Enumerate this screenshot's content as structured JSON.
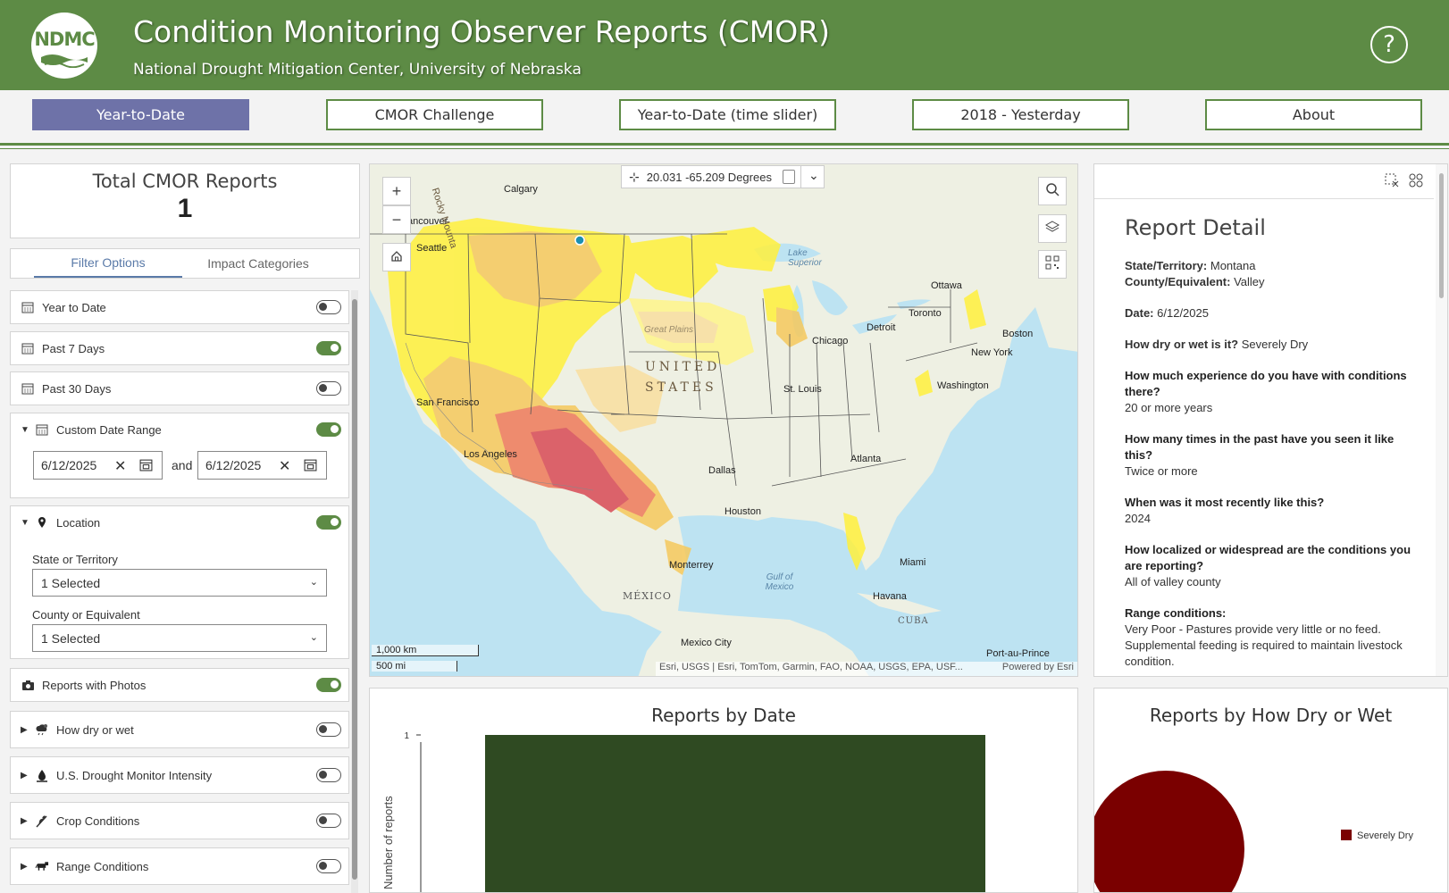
{
  "header": {
    "logo_text": "NDMC",
    "title": "Condition Monitoring Observer Reports (CMOR)",
    "subtitle": "National Drought Mitigation Center, University of Nebraska",
    "help_glyph": "?"
  },
  "nav": {
    "tabs": [
      {
        "label": "Year-to-Date",
        "active": true
      },
      {
        "label": "CMOR Challenge",
        "active": false
      },
      {
        "label": "Year-to-Date (time slider)",
        "active": false
      },
      {
        "label": "2018 - Yesterday",
        "active": false
      },
      {
        "label": "About",
        "active": false
      }
    ]
  },
  "total": {
    "title": "Total CMOR Reports",
    "count": "1"
  },
  "filter_tabs": {
    "filter_options": "Filter Options",
    "impact_categories": "Impact Categories"
  },
  "filters": {
    "year_to_date": {
      "label": "Year to Date",
      "on": false
    },
    "past_7_days": {
      "label": "Past 7 Days",
      "on": true
    },
    "past_30_days": {
      "label": "Past 30 Days",
      "on": false
    },
    "custom_range": {
      "label": "Custom Date Range",
      "on": true,
      "from": "6/12/2025",
      "and_label": "and",
      "to": "6/12/2025"
    },
    "location": {
      "label": "Location",
      "on": true,
      "state_label": "State or Territory",
      "state_value": "1 Selected",
      "county_label": "County or Equivalent",
      "county_value": "1 Selected"
    },
    "photos": {
      "label": "Reports with Photos",
      "on": true
    },
    "how_dry": {
      "label": "How dry or wet",
      "on": false
    },
    "usdm": {
      "label": "U.S. Drought Monitor Intensity",
      "on": false
    },
    "crop": {
      "label": "Crop Conditions",
      "on": false
    },
    "range": {
      "label": "Range Conditions",
      "on": false
    }
  },
  "map": {
    "coordinates": "20.031 -65.209 Degrees",
    "labels": {
      "calgary": "Calgary",
      "vancouver": "ancouver",
      "seattle": "Seattle",
      "rocky": "Rocky Mounta",
      "great_plains": "Great Plains",
      "united": "UNITED",
      "states": "STATES",
      "lake_superior": "Lake Superior",
      "ottawa": "Ottawa",
      "toronto": "Toronto",
      "detroit": "Detroit",
      "chicago": "Chicago",
      "boston": "Boston",
      "new_york": "New York",
      "washington": "Washington",
      "st_louis": "St. Louis",
      "san_francisco": "San Francisco",
      "los_angeles": "Los Angeles",
      "dallas": "Dallas",
      "atlanta": "Atlanta",
      "houston": "Houston",
      "monterrey": "Monterrey",
      "miami": "Miami",
      "gulf": "Gulf of Mexico",
      "mexico": "MÉXICO",
      "havana": "Havana",
      "cuba": "CUBA",
      "mexico_city": "Mexico City",
      "port_au_prince": "Port-au-Prince"
    },
    "scale_km": "1,000 km",
    "scale_mi": "500 mi",
    "attribution": "Esri, USGS | Esri, TomTom, Garmin, FAO, NOAA, USGS, EPA, USF...",
    "powered_by": "Powered by Esri"
  },
  "detail": {
    "title": "Report Detail",
    "state_label": "State/Territory:",
    "state_value": "Montana",
    "county_label": "County/Equivalent:",
    "county_value": "Valley",
    "date_label": "Date:",
    "date_value": "6/12/2025",
    "dry_label": "How dry or wet is it?",
    "dry_value": "Severely Dry",
    "exp_label": "How much experience do you have with conditions there?",
    "exp_value": "20 or more years",
    "seen_label": "How many times in the past have you seen it like this?",
    "seen_value": "Twice or more",
    "recent_label": "When was it most recently like this?",
    "recent_value": "2024",
    "local_label": "How localized or widespread are the conditions you are reporting?",
    "local_value": "All of valley county",
    "range_label": "Range conditions:",
    "range_value": "Very Poor - Pastures provide very little or no feed. Supplemental feeding is required to maintain livestock condition."
  },
  "chart_data": [
    {
      "type": "bar",
      "title": "Reports by Date",
      "ylabel": "Number of reports",
      "categories": [
        ""
      ],
      "values": [
        1
      ],
      "yticks": [
        "1"
      ],
      "ylim": [
        0,
        1
      ],
      "color": "#2f4a22"
    },
    {
      "type": "pie",
      "title": "Reports by How Dry or Wet",
      "labels": [
        "Severely Dry"
      ],
      "values": [
        1
      ],
      "colors": [
        "#7a0000"
      ],
      "legend": "right"
    }
  ]
}
